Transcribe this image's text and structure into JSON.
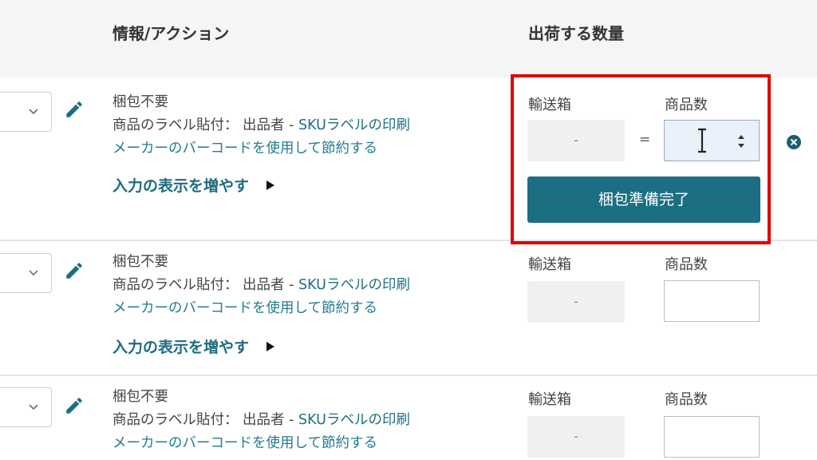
{
  "header": {
    "col_info": "情報/アクション",
    "col_quantity": "出荷する数量"
  },
  "rows": [
    {
      "packing": "梱包不要",
      "label_prefix": "商品のラベル貼付： 出品者 - ",
      "label_link": "SKUラベルの印刷",
      "barcode_link": "メーカーのバーコードを使用して節約する",
      "more_inputs": "入力の表示を増やす",
      "box_label": "輸送箱",
      "box_value": "-",
      "qty_label": "商品数",
      "equals": "=",
      "pack_button": "梱包準備完了"
    },
    {
      "packing": "梱包不要",
      "label_prefix": "商品のラベル貼付： 出品者 - ",
      "label_link": "SKUラベルの印刷",
      "barcode_link": "メーカーのバーコードを使用して節約する",
      "more_inputs": "入力の表示を増やす",
      "box_label": "輸送箱",
      "box_value": "-",
      "qty_label": "商品数"
    },
    {
      "packing": "梱包不要",
      "label_prefix": "商品のラベル貼付： 出品者 - ",
      "label_link": "SKUラベルの印刷",
      "barcode_link": "メーカーのバーコードを使用して節約する",
      "box_label": "輸送箱",
      "box_value": "-",
      "qty_label": "商品数"
    }
  ],
  "colors": {
    "accent": "#1c6f83",
    "link": "#237c8d",
    "highlight": "#e00000",
    "header_bg": "#f4f5f6"
  },
  "icons": [
    "chevron-down-icon",
    "pencil-icon",
    "play-icon",
    "spinner-arrows-icon",
    "text-cursor-icon",
    "remove-circle-icon"
  ]
}
